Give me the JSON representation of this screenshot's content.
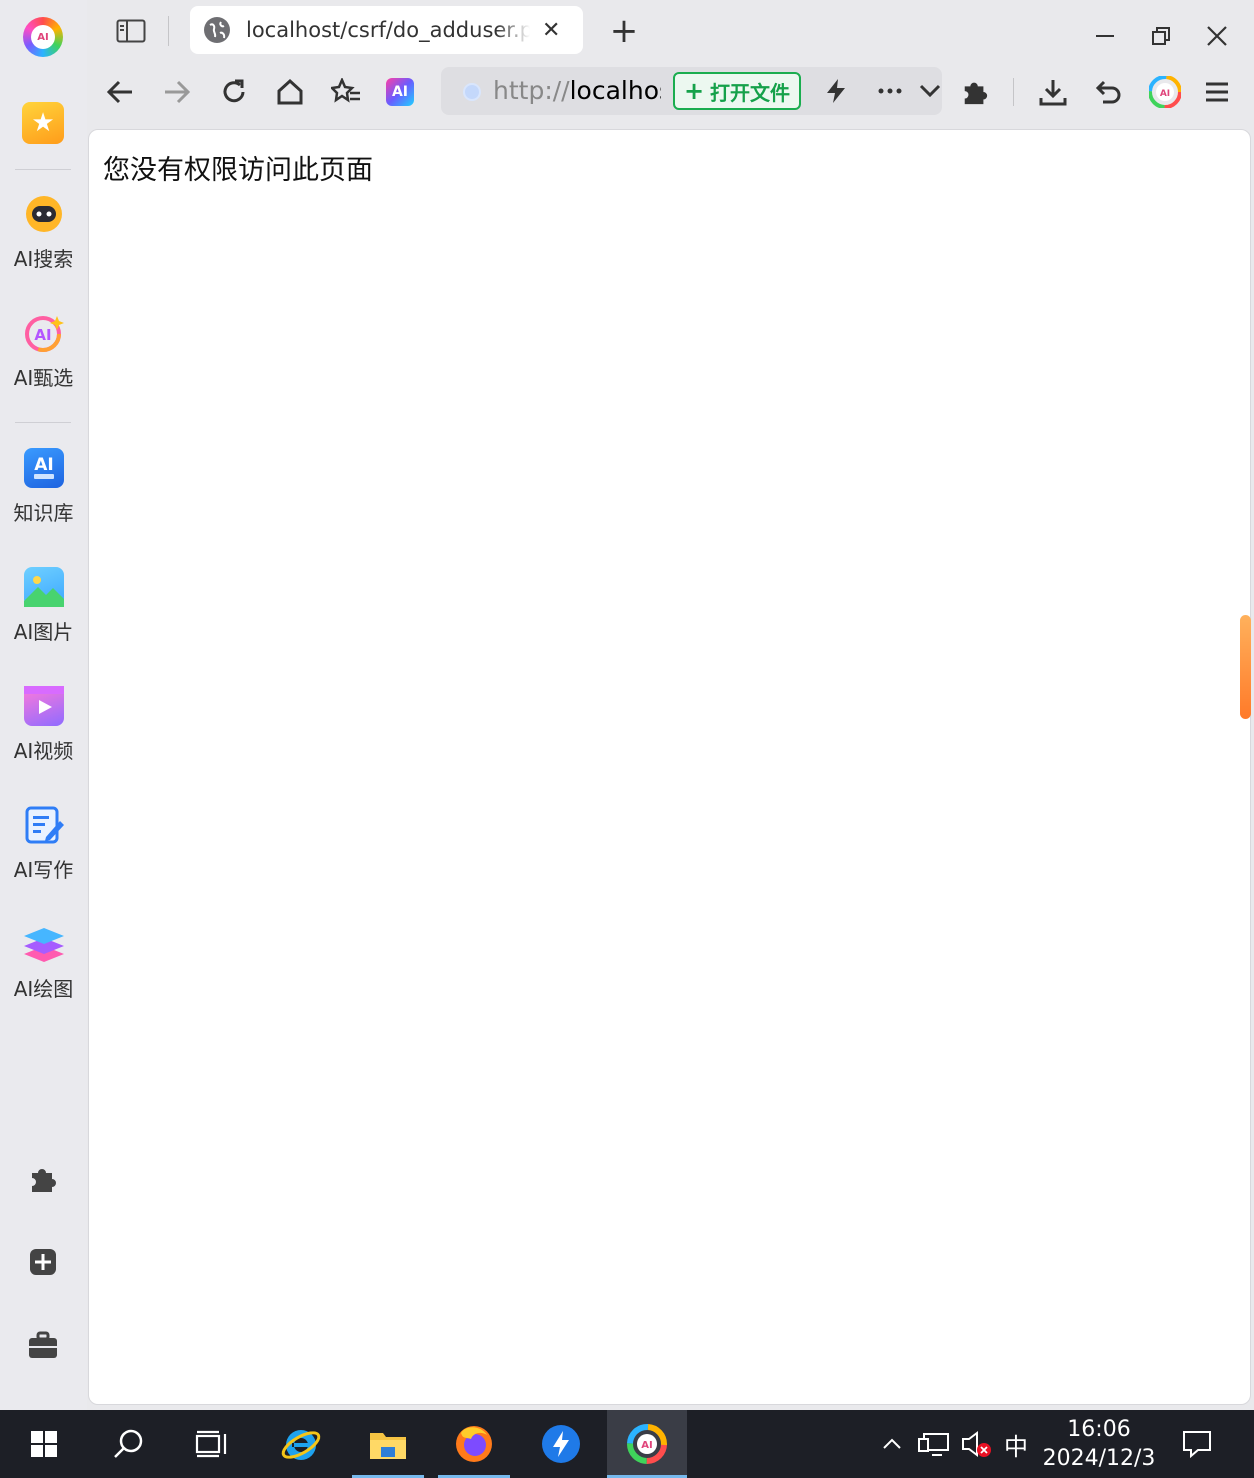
{
  "browser": {
    "tab": {
      "title": "localhost/csrf/do_adduser.php"
    },
    "new_tab_symbol": "+",
    "close_tab_symbol": "✕",
    "address": {
      "scheme": "http://",
      "host_visible": "localhos"
    },
    "open_file_label": "打开文件",
    "open_file_plus": "+",
    "ai_badge_text": "AI"
  },
  "sidebar": {
    "logo_text": "AI",
    "items": [
      {
        "label": "AI搜索",
        "icon": "robot-face-icon"
      },
      {
        "label": "AI甄选",
        "icon": "ai-sparkle-icon"
      },
      {
        "label": "知识库",
        "icon": "knowledge-book-icon"
      },
      {
        "label": "AI图片",
        "icon": "picture-icon"
      },
      {
        "label": "AI视频",
        "icon": "video-play-icon"
      },
      {
        "label": "AI写作",
        "icon": "writing-pen-icon"
      },
      {
        "label": "AI绘图",
        "icon": "layers-icon"
      }
    ],
    "tools": [
      "puzzle-icon",
      "plus-grid-icon",
      "toolbox-icon"
    ]
  },
  "page": {
    "message": "您没有权限访问此页面"
  },
  "taskbar": {
    "time": "16:06",
    "date": "2024/12/3",
    "ime": "中"
  },
  "colors": {
    "open_file_green": "#15a14a",
    "scroll_hint_orange": "#ff7a29",
    "taskbar_bg": "#1d1f26"
  }
}
